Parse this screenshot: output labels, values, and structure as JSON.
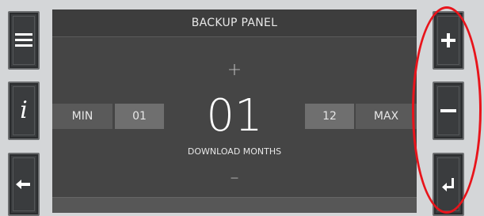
{
  "panel": {
    "title": "BACKUP PANEL",
    "min_label": "MIN",
    "min_value": "01",
    "max_value": "12",
    "max_label": "MAX",
    "current_value": "01",
    "value_label": "DOWNLOAD MONTHS",
    "up_symbol": "+",
    "down_symbol": "–"
  },
  "side_buttons_left": [
    {
      "icon": "menu-icon"
    },
    {
      "icon": "info-icon",
      "glyph": "i"
    },
    {
      "icon": "back-arrow-icon"
    }
  ],
  "side_buttons_right": [
    {
      "icon": "plus-icon"
    },
    {
      "icon": "minus-icon"
    },
    {
      "icon": "enter-icon"
    }
  ],
  "colors": {
    "page_bg": "#d4d6d8",
    "panel_bg": "#454545",
    "button_bg": "#3a3c3e",
    "highlight": "#e8141b"
  }
}
